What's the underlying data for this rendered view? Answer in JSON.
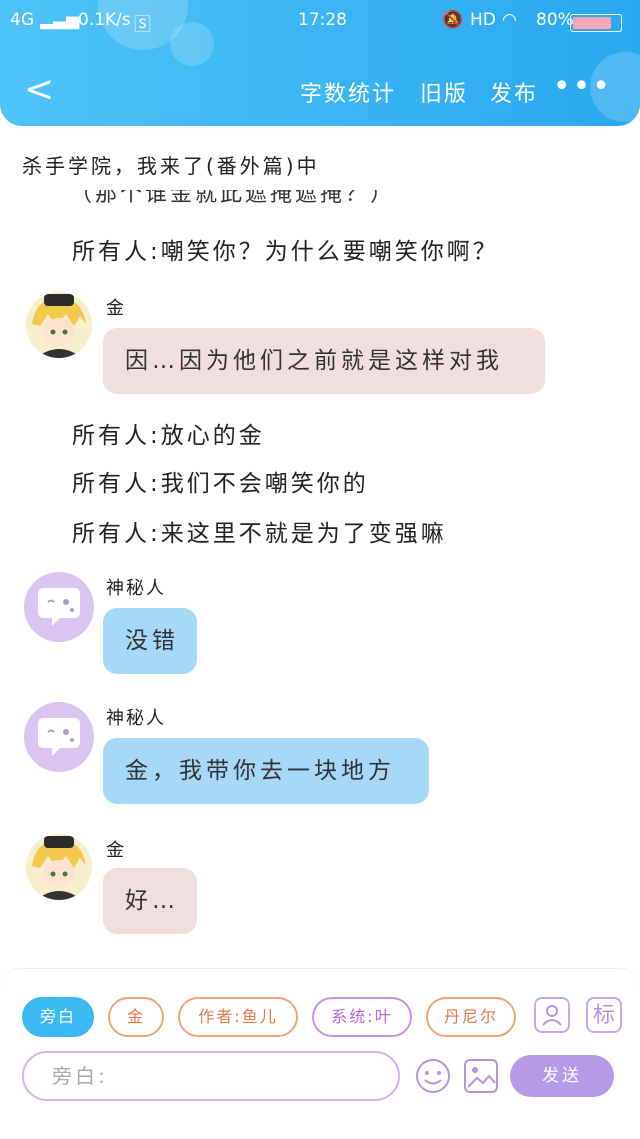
{
  "status_bar": {
    "network": "4G",
    "speed": "0.1K/s",
    "time": "17:28",
    "hd": "HD",
    "battery": "80%"
  },
  "navbar": {
    "word_count": "字数统计",
    "old_version": "旧版",
    "publish": "发布"
  },
  "story_title": "杀手学院，我来了(番外篇)中",
  "messages": [
    {
      "type": "partial",
      "text": "（那个谁金就此遮掩遮掩？）"
    },
    {
      "type": "narration",
      "text": "所有人:嘲笑你？为什么要嘲笑你啊？"
    },
    {
      "type": "bubble",
      "speaker": "金",
      "text": "因…因为他们之前就是这样对我"
    },
    {
      "type": "narration",
      "text": "所有人:放心的金"
    },
    {
      "type": "narration",
      "text": "所有人:我们不会嘲笑你的"
    },
    {
      "type": "narration",
      "text": "所有人:来这里不就是为了变强嘛"
    },
    {
      "type": "bubble",
      "speaker": "神秘人",
      "text": "没错"
    },
    {
      "type": "bubble",
      "speaker": "神秘人",
      "text": "金，我带你去一块地方"
    },
    {
      "type": "bubble",
      "speaker": "金",
      "text": "好…"
    }
  ],
  "bottom_bar": {
    "chips": [
      "旁白",
      "金",
      "作者:鱼儿",
      "系统:叶",
      "丹尼尔"
    ],
    "tag_tool": "标",
    "input_placeholder": "旁白:",
    "send_label": "发送"
  },
  "colors": {
    "header": "#29a8f0",
    "bubble_pink": "#f1dfdf",
    "bubble_blue": "#a6d9f8",
    "send": "#b49ae9"
  }
}
